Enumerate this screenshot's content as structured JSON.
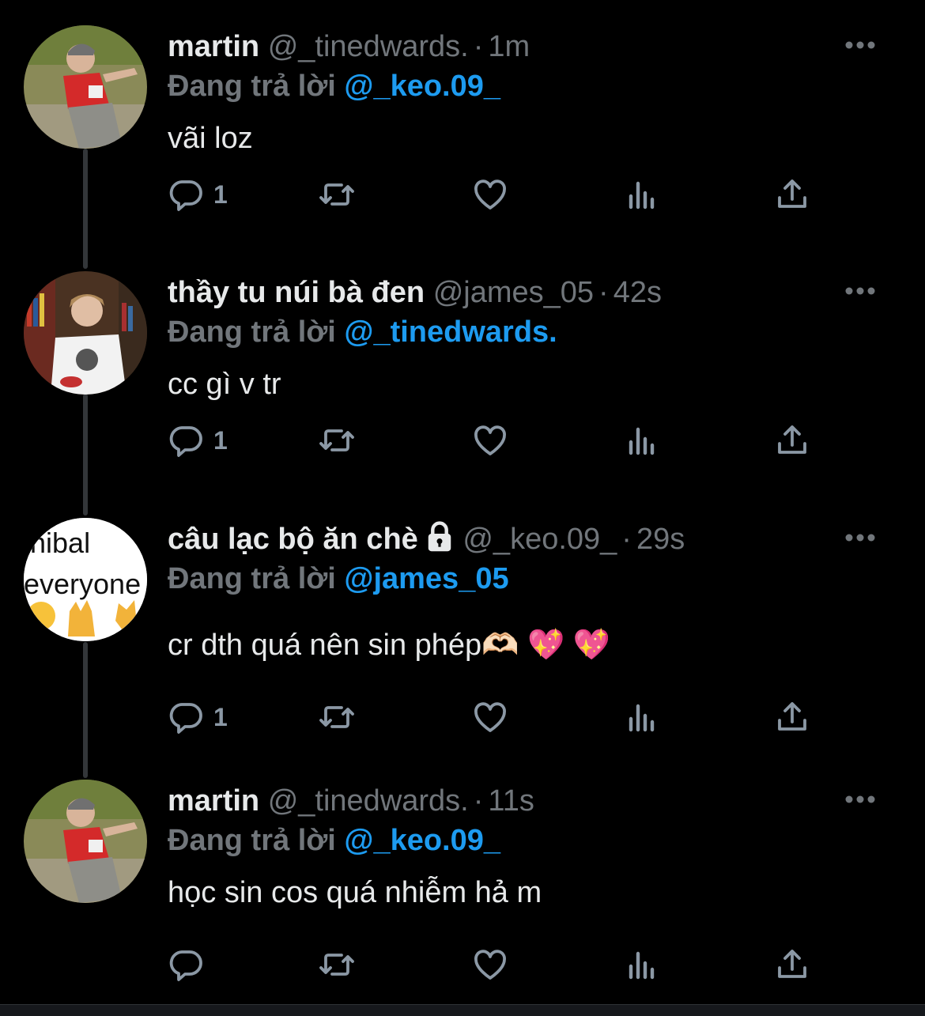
{
  "replying_prefix": "Đang trả lời",
  "tweets": [
    {
      "name": "martin",
      "handle": "@_tinedwards.",
      "sep": "·",
      "time": "1m",
      "replying_to": "@_keo.09_",
      "text": "vãi loz",
      "reply_count": "1"
    },
    {
      "name": "thầy tu núi bà đen",
      "handle": "@james_05",
      "sep": "·",
      "time": "42s",
      "replying_to": "@_tinedwards.",
      "text": "cc gì v tr",
      "reply_count": "1"
    },
    {
      "name": " câu lạc bộ ăn chè",
      "handle": "@_keo.09_",
      "sep": "·",
      "time": "29s",
      "replying_to": "@james_05",
      "text": "cr dth quá nên sin phép🫶🏻 💖 💖",
      "reply_count": "1",
      "avatar_text_1": "nibal",
      "avatar_text_2": "everyone"
    },
    {
      "name": "martin",
      "handle": "@_tinedwards.",
      "sep": "·",
      "time": "11s",
      "replying_to": "@_keo.09_",
      "text": "học sin cos quá nhiễm hả m",
      "reply_count": ""
    }
  ],
  "colors": {
    "background": "#000000",
    "text": "#e7e9ea",
    "muted": "#71767b",
    "link": "#1d9bf0",
    "icon": "#8b98a5",
    "thread_line": "#333639"
  },
  "icons": {
    "reply": "reply-icon",
    "retweet": "retweet-icon",
    "like": "heart-icon",
    "views": "views-icon",
    "share": "share-icon",
    "more": "more-icon",
    "lock": "lock-icon"
  }
}
